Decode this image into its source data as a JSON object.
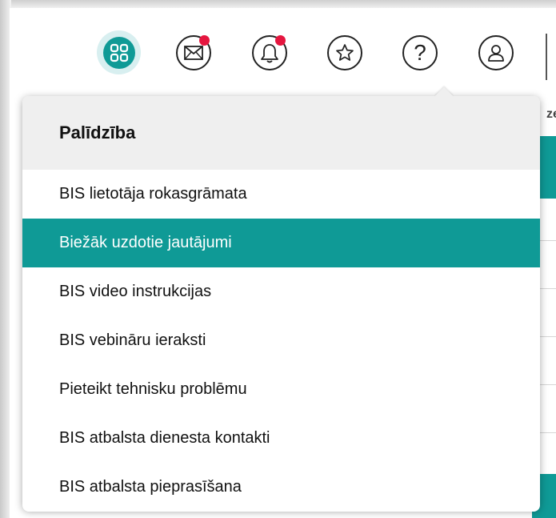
{
  "topbar": {
    "icons": [
      {
        "name": "apps-grid-icon",
        "active": true
      },
      {
        "name": "mail-icon",
        "has_badge": true
      },
      {
        "name": "bell-icon",
        "has_badge": true
      },
      {
        "name": "star-icon",
        "has_badge": false
      },
      {
        "name": "help-icon",
        "glyph": "?",
        "has_badge": false
      },
      {
        "name": "user-icon",
        "has_badge": false
      }
    ],
    "accent_color": "#0f9a96",
    "badge_color": "#e5163f"
  },
  "background": {
    "partial_text": "ze"
  },
  "help_menu": {
    "title": "Palīdzība",
    "items": [
      {
        "label": "BIS lietotāja rokasgrāmata",
        "active": false
      },
      {
        "label": "Biežāk uzdotie jautājumi",
        "active": true
      },
      {
        "label": "BIS video instrukcijas",
        "active": false
      },
      {
        "label": "BIS vebināru ieraksti",
        "active": false
      },
      {
        "label": "Pieteikt tehnisku problēmu",
        "active": false
      },
      {
        "label": "BIS atbalsta dienesta kontakti",
        "active": false
      },
      {
        "label": "BIS atbalsta pieprasīšana",
        "active": false
      }
    ]
  }
}
